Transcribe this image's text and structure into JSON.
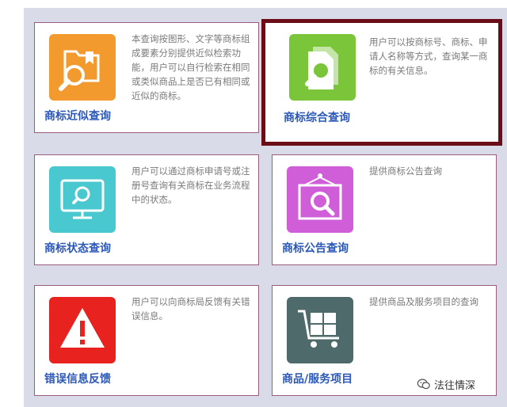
{
  "cards": [
    {
      "title": "商标近似查询",
      "description": "本查询按图形、文字等商标组成要素分别提供近似检索功能，用户可以自行检索在相同或类似商品上是否已有相同或近似的商标。",
      "icon": "folder-search-icon",
      "color": "#f29a2e"
    },
    {
      "title": "商标综合查询",
      "description": "用户可以按商标号、商标、申请人名称等方式，查询某一商标的有关信息。",
      "icon": "document-search-icon",
      "color": "#7ac53a",
      "highlighted": true
    },
    {
      "title": "商标状态查询",
      "description": "用户可以通过商标申请号或注册号查询有关商标在业务流程中的状态。",
      "icon": "monitor-search-icon",
      "color": "#49c9cf"
    },
    {
      "title": "商标公告查询",
      "description": "提供商标公告查询",
      "icon": "bulletin-search-icon",
      "color": "#cf5ed8"
    },
    {
      "title": "错误信息反馈",
      "description": "用户可以向商标局反馈有关错误信息。",
      "icon": "warning-icon",
      "color": "#e8231f"
    },
    {
      "title": "商品/服务项目",
      "description": "提供商品及服务项目的查询",
      "icon": "shopping-cart-icon",
      "color": "#4e6a6a"
    }
  ],
  "watermark": {
    "text": "法往情深",
    "icon": "wechat-icon"
  }
}
